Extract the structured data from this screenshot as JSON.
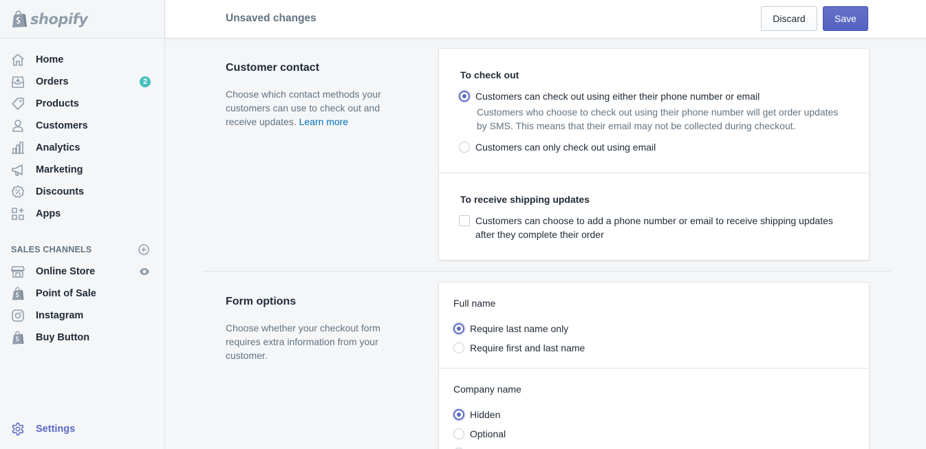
{
  "brand": {
    "name": "shopify"
  },
  "topbar": {
    "title": "Unsaved changes",
    "discard_label": "Discard",
    "save_label": "Save"
  },
  "sidebar": {
    "items": [
      {
        "label": "Home",
        "icon": "home-icon"
      },
      {
        "label": "Orders",
        "icon": "orders-icon",
        "badge": "2"
      },
      {
        "label": "Products",
        "icon": "tag-icon"
      },
      {
        "label": "Customers",
        "icon": "person-icon"
      },
      {
        "label": "Analytics",
        "icon": "bar-chart-icon"
      },
      {
        "label": "Marketing",
        "icon": "megaphone-icon"
      },
      {
        "label": "Discounts",
        "icon": "discount-icon"
      },
      {
        "label": "Apps",
        "icon": "apps-icon"
      }
    ],
    "sales_channels_title": "SALES CHANNELS",
    "channels": [
      {
        "label": "Online Store",
        "icon": "store-icon"
      },
      {
        "label": "Point of Sale",
        "icon": "shopify-bag-icon"
      },
      {
        "label": "Instagram",
        "icon": "instagram-icon"
      },
      {
        "label": "Buy Button",
        "icon": "shopify-bag-icon"
      }
    ],
    "settings_label": "Settings"
  },
  "customer_contact": {
    "title": "Customer contact",
    "description": "Choose which contact methods your customers can use to check out and receive updates.",
    "learn_more": "Learn more",
    "checkout_heading": "To check out",
    "option_phone_or_email": "Customers can check out using either their phone number or email",
    "option_phone_or_email_help": "Customers who choose to check out using their phone number will get order updates by SMS. This means that their email may not be collected during checkout.",
    "option_email_only": "Customers can only check out using email",
    "shipping_heading": "To receive shipping updates",
    "shipping_option": "Customers can choose to add a phone number or email to receive shipping updates after they complete their order"
  },
  "form_options": {
    "title": "Form options",
    "description": "Choose whether your checkout form requires extra information from your customer.",
    "full_name_heading": "Full name",
    "full_name_option_1": "Require last name only",
    "full_name_option_2": "Require first and last name",
    "company_heading": "Company name",
    "company_option_1": "Hidden",
    "company_option_2": "Optional"
  },
  "colors": {
    "accent": "#5c6ac4",
    "badge": "#47c1bf",
    "link": "#006fbb"
  }
}
